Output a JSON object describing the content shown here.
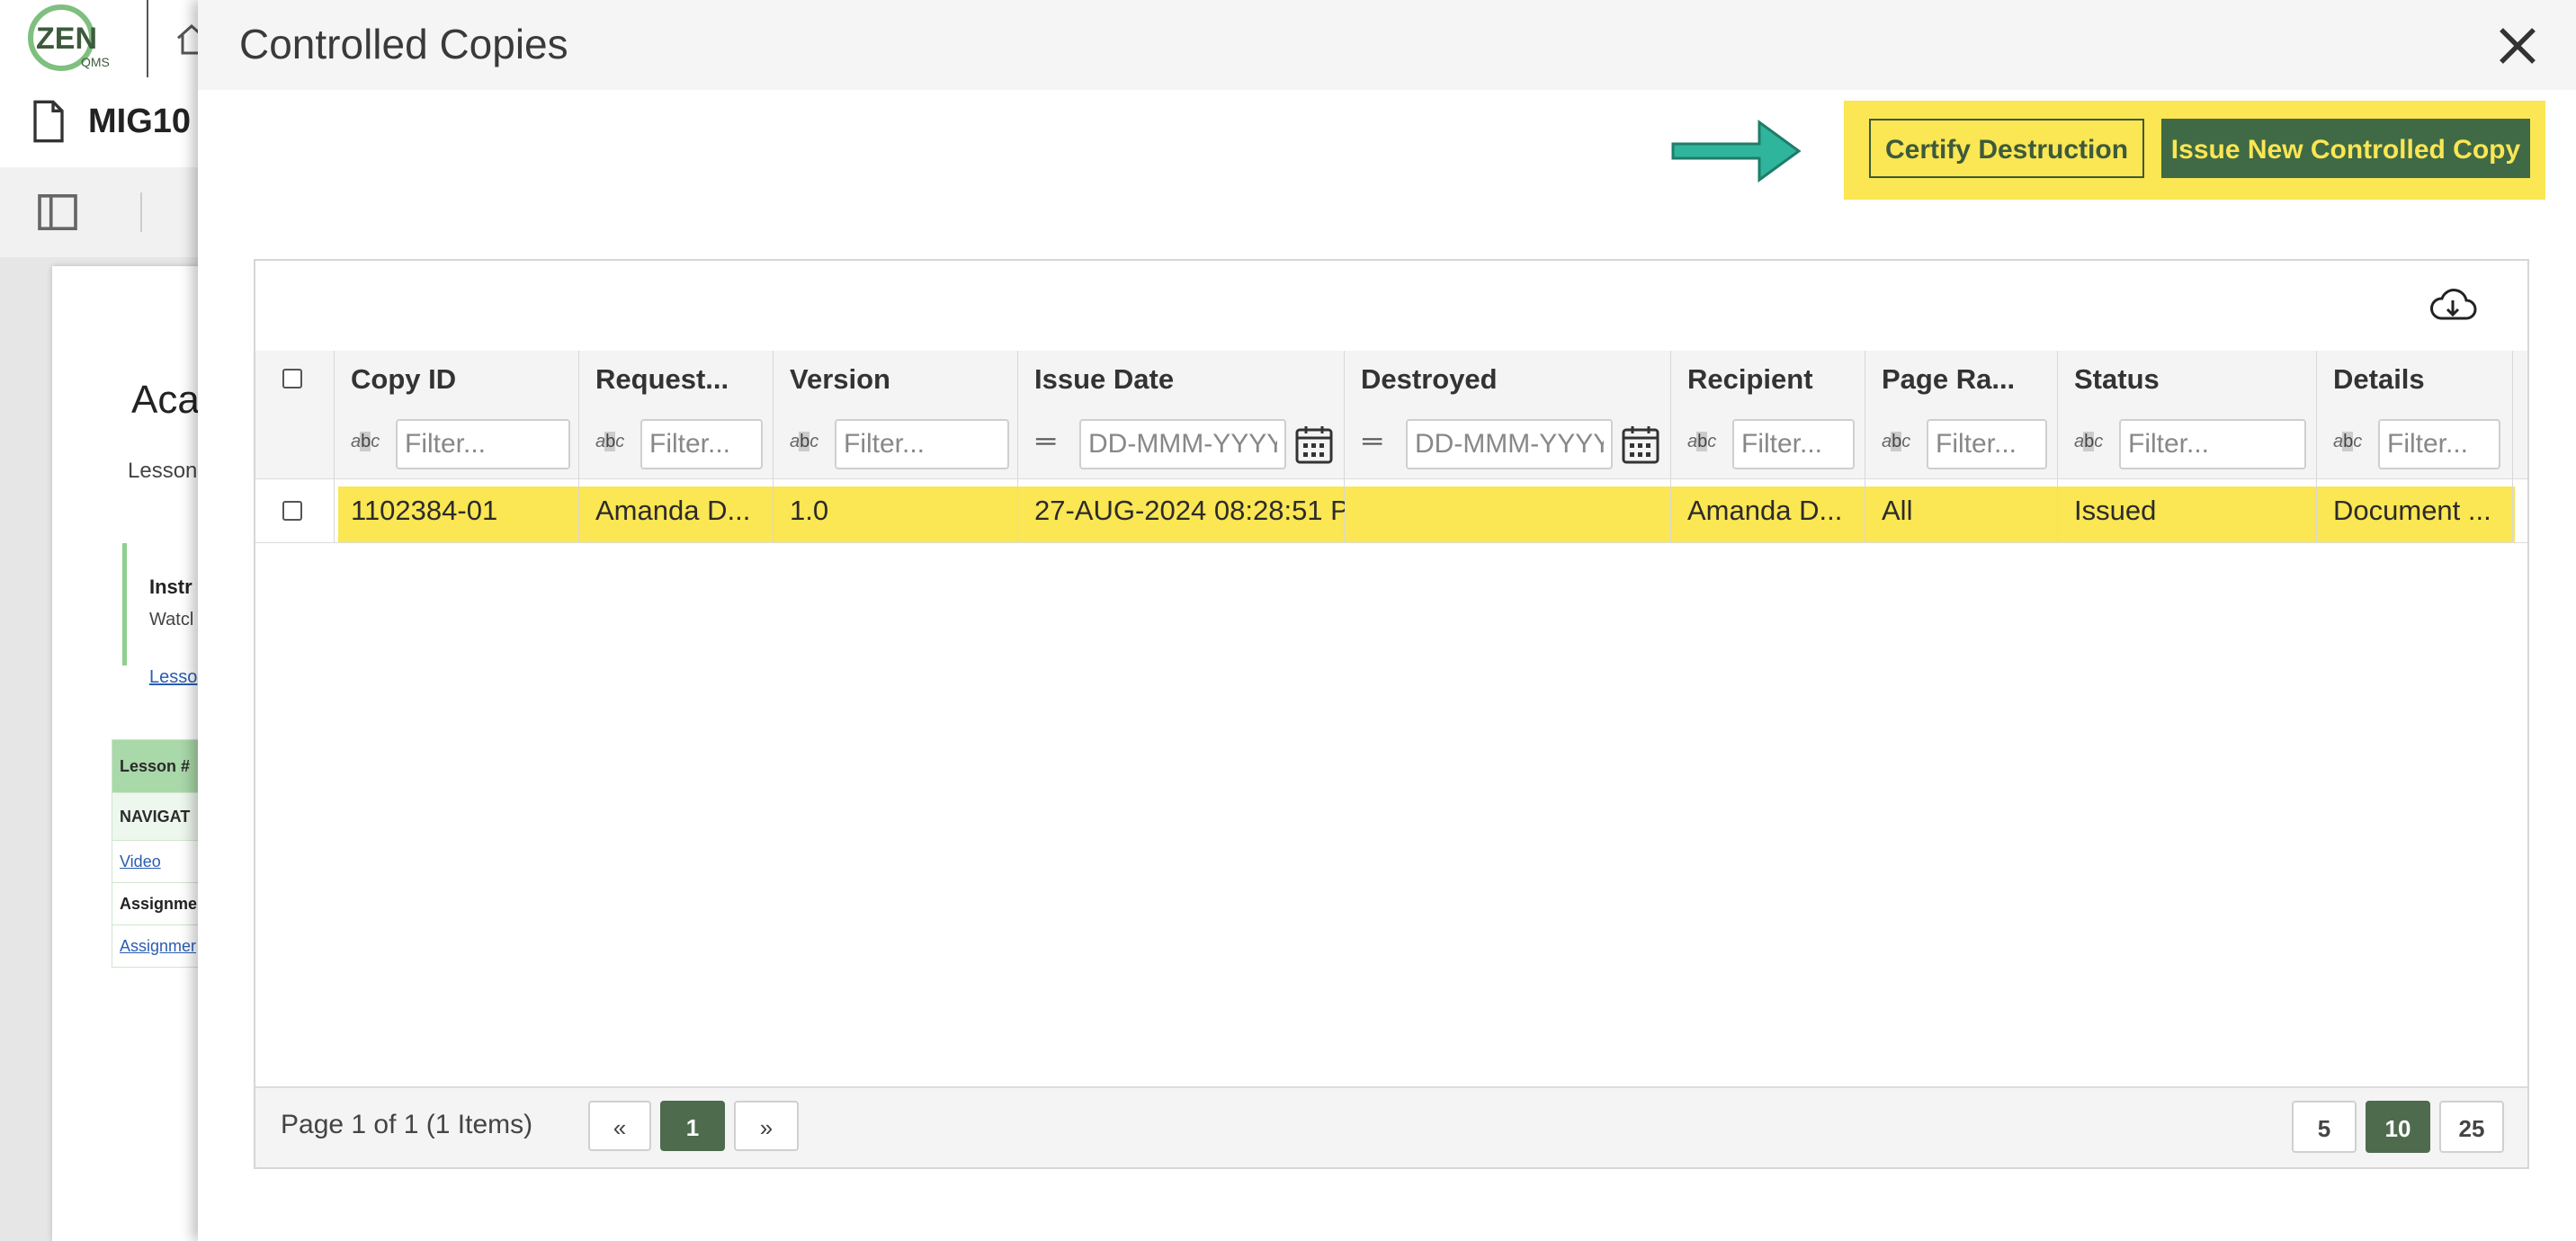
{
  "app": {
    "logo_text": "ZEN",
    "logo_sub": "QMS"
  },
  "background": {
    "doc_title": "MIG10",
    "heading": "Aca",
    "sub": "Lesson",
    "instr_title": "Instr",
    "instr_text": "Watcl",
    "instr_link": "Lesso",
    "table_rows": [
      "Lesson #",
      "NAVIGAT",
      "Video",
      "Assignmer",
      "Assignmer"
    ]
  },
  "modal": {
    "title": "Controlled Copies",
    "certify_label": "Certify Destruction",
    "issue_label": "Issue New Controlled Copy"
  },
  "grid": {
    "columns": [
      "Copy ID",
      "Request...",
      "Version",
      "Issue Date",
      "Destroyed",
      "Recipient",
      "Page Ra...",
      "Status",
      "Details"
    ],
    "filter_placeholder": "Filter...",
    "date_placeholder": "DD-MMM-YYYY",
    "rows": [
      {
        "copy_id": "1102384-01",
        "requester": "Amanda D...",
        "version": "1.0",
        "issue_date": "27-AUG-2024 08:28:51 P",
        "destroyed": "",
        "recipient": "Amanda D...",
        "page_range": "All",
        "status": "Issued",
        "details": "Document ..."
      }
    ],
    "footer": {
      "page_info": "Page 1 of 1 (1 Items)",
      "prev": "«",
      "current": "1",
      "next": "»",
      "sizes": [
        "5",
        "10",
        "25"
      ],
      "active_size": "10"
    }
  },
  "colors": {
    "highlight": "#fbe653",
    "primary": "#3f6a45",
    "arrow": "#2fb59c"
  },
  "icons": [
    "home-icon",
    "document-icon",
    "sidebar-toggle-icon",
    "close-icon",
    "arrow-right-icon",
    "cloud-download-icon",
    "calendar-icon",
    "text-filter-icon",
    "equals-filter-icon"
  ]
}
